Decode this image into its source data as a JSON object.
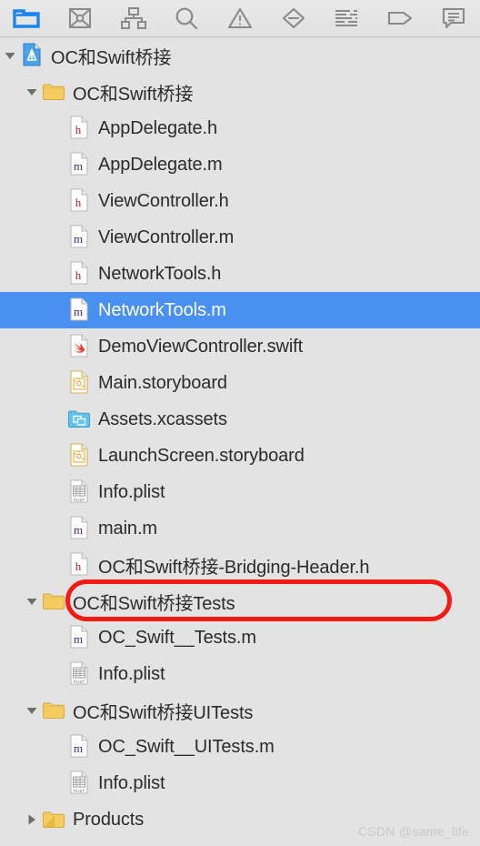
{
  "window": {
    "title": "Xcode Project Navigator",
    "background_color": "#e3e3e3",
    "selection_color": "#4a90f0",
    "annotation_color": "#f51b14"
  },
  "toolbar": {
    "items": [
      {
        "id": "project-navigator",
        "label": "Project Navigator",
        "icon": "folder-icon",
        "selected": true
      },
      {
        "id": "source-control-navigator",
        "label": "Source Control Navigator",
        "icon": "source-control-icon",
        "selected": false
      },
      {
        "id": "symbol-navigator",
        "label": "Symbol Navigator",
        "icon": "symbol-hierarchy-icon",
        "selected": false
      },
      {
        "id": "find-navigator",
        "label": "Find Navigator",
        "icon": "search-icon",
        "selected": false
      },
      {
        "id": "issue-navigator",
        "label": "Issue Navigator",
        "icon": "warning-triangle-icon",
        "selected": false
      },
      {
        "id": "test-navigator",
        "label": "Test Navigator",
        "icon": "diamond-minus-icon",
        "selected": false
      },
      {
        "id": "report-navigator",
        "label": "Report Navigator",
        "icon": "report-lines-icon",
        "selected": false
      },
      {
        "id": "breakpoint-navigator",
        "label": "Breakpoint Navigator",
        "icon": "tag-icon",
        "selected": false
      },
      {
        "id": "log-navigator",
        "label": "Log Navigator",
        "icon": "speech-bubble-icon",
        "selected": false
      }
    ]
  },
  "tree": {
    "rows": [
      {
        "name": "OC和Swift桥接",
        "icon": "xcode-project-icon",
        "indent": 0,
        "twisty": "expanded",
        "selected": false
      },
      {
        "name": "OC和Swift桥接",
        "icon": "folder-yellow-icon",
        "indent": 1,
        "twisty": "expanded",
        "selected": false
      },
      {
        "name": "AppDelegate.h",
        "icon": "header-file-icon",
        "indent": 2,
        "twisty": "none",
        "selected": false
      },
      {
        "name": "AppDelegate.m",
        "icon": "objc-file-icon",
        "indent": 2,
        "twisty": "none",
        "selected": false
      },
      {
        "name": "ViewController.h",
        "icon": "header-file-icon",
        "indent": 2,
        "twisty": "none",
        "selected": false
      },
      {
        "name": "ViewController.m",
        "icon": "objc-file-icon",
        "indent": 2,
        "twisty": "none",
        "selected": false
      },
      {
        "name": "NetworkTools.h",
        "icon": "header-file-icon",
        "indent": 2,
        "twisty": "none",
        "selected": false
      },
      {
        "name": "NetworkTools.m",
        "icon": "objc-file-icon",
        "indent": 2,
        "twisty": "none",
        "selected": true
      },
      {
        "name": "DemoViewController.swift",
        "icon": "swift-file-icon",
        "indent": 2,
        "twisty": "none",
        "selected": false
      },
      {
        "name": "Main.storyboard",
        "icon": "storyboard-file-icon",
        "indent": 2,
        "twisty": "none",
        "selected": false
      },
      {
        "name": "Assets.xcassets",
        "icon": "xcassets-icon",
        "indent": 2,
        "twisty": "none",
        "selected": false
      },
      {
        "name": "LaunchScreen.storyboard",
        "icon": "storyboard-file-icon",
        "indent": 2,
        "twisty": "none",
        "selected": false
      },
      {
        "name": "Info.plist",
        "icon": "plist-file-icon",
        "indent": 2,
        "twisty": "none",
        "selected": false
      },
      {
        "name": "main.m",
        "icon": "objc-file-icon",
        "indent": 2,
        "twisty": "none",
        "selected": false
      },
      {
        "name": "OC和Swift桥接-Bridging-Header.h",
        "icon": "header-file-icon",
        "indent": 2,
        "twisty": "none",
        "selected": false,
        "annotated": true
      },
      {
        "name": "OC和Swift桥接Tests",
        "icon": "folder-yellow-icon",
        "indent": 1,
        "twisty": "expanded",
        "selected": false
      },
      {
        "name": "OC_Swift__Tests.m",
        "icon": "objc-file-icon",
        "indent": 2,
        "twisty": "none",
        "selected": false
      },
      {
        "name": "Info.plist",
        "icon": "plist-file-icon",
        "indent": 2,
        "twisty": "none",
        "selected": false
      },
      {
        "name": "OC和Swift桥接UITests",
        "icon": "folder-yellow-icon",
        "indent": 1,
        "twisty": "expanded",
        "selected": false
      },
      {
        "name": "OC_Swift__UITests.m",
        "icon": "objc-file-icon",
        "indent": 2,
        "twisty": "none",
        "selected": false
      },
      {
        "name": "Info.plist",
        "icon": "plist-file-icon",
        "indent": 2,
        "twisty": "none",
        "selected": false
      },
      {
        "name": "Products",
        "icon": "folder-products-icon",
        "indent": 1,
        "twisty": "collapsed",
        "selected": false
      }
    ]
  },
  "watermark": {
    "text": "CSDN @same_life"
  }
}
